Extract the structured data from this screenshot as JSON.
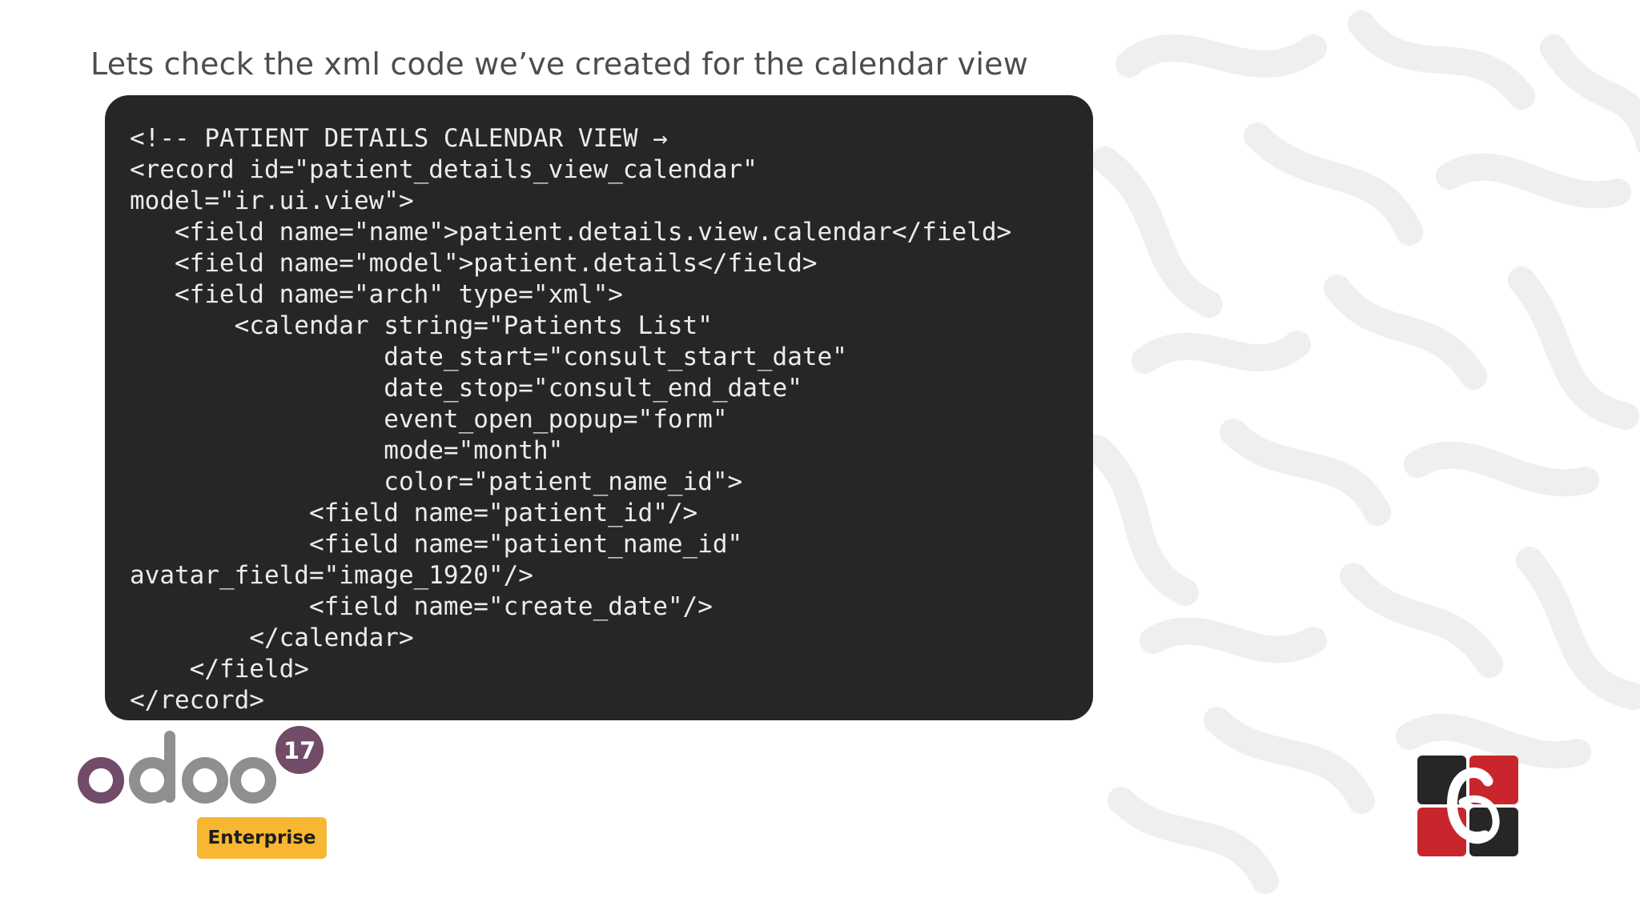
{
  "slide": {
    "title": "Lets check the xml code we’ve created for the calendar view"
  },
  "code": {
    "lines": [
      "<!-- PATIENT DETAILS CALENDAR VIEW →",
      "<record id=\"patient_details_view_calendar\"",
      "model=\"ir.ui.view\">",
      "   <field name=\"name\">patient.details.view.calendar</field>",
      "   <field name=\"model\">patient.details</field>",
      "   <field name=\"arch\" type=\"xml\">",
      "       <calendar string=\"Patients List\"",
      "                 date_start=\"consult_start_date\"",
      "                 date_stop=\"consult_end_date\"",
      "                 event_open_popup=\"form\"",
      "                 mode=\"month\"",
      "                 color=\"patient_name_id\">",
      "            <field name=\"patient_id\"/>",
      "            <field name=\"patient_name_id\"",
      "avatar_field=\"image_1920\"/>",
      "            <field name=\"create_date\"/>",
      "        </calendar>",
      "    </field>",
      "</record>"
    ]
  },
  "logos": {
    "odoo": {
      "wordmark": "odoo",
      "version": "17",
      "edition": "Enterprise"
    },
    "brand_mark": "C-monogram-logo"
  },
  "colors": {
    "code_background": "#262626",
    "code_text": "#ececec",
    "title_text": "#4d4d4d",
    "odoo_purple": "#714b67",
    "odoo_grey": "#8f8f8f",
    "enterprise_badge": "#f7b733",
    "brand_red": "#c8262c",
    "brand_dark": "#262626"
  }
}
